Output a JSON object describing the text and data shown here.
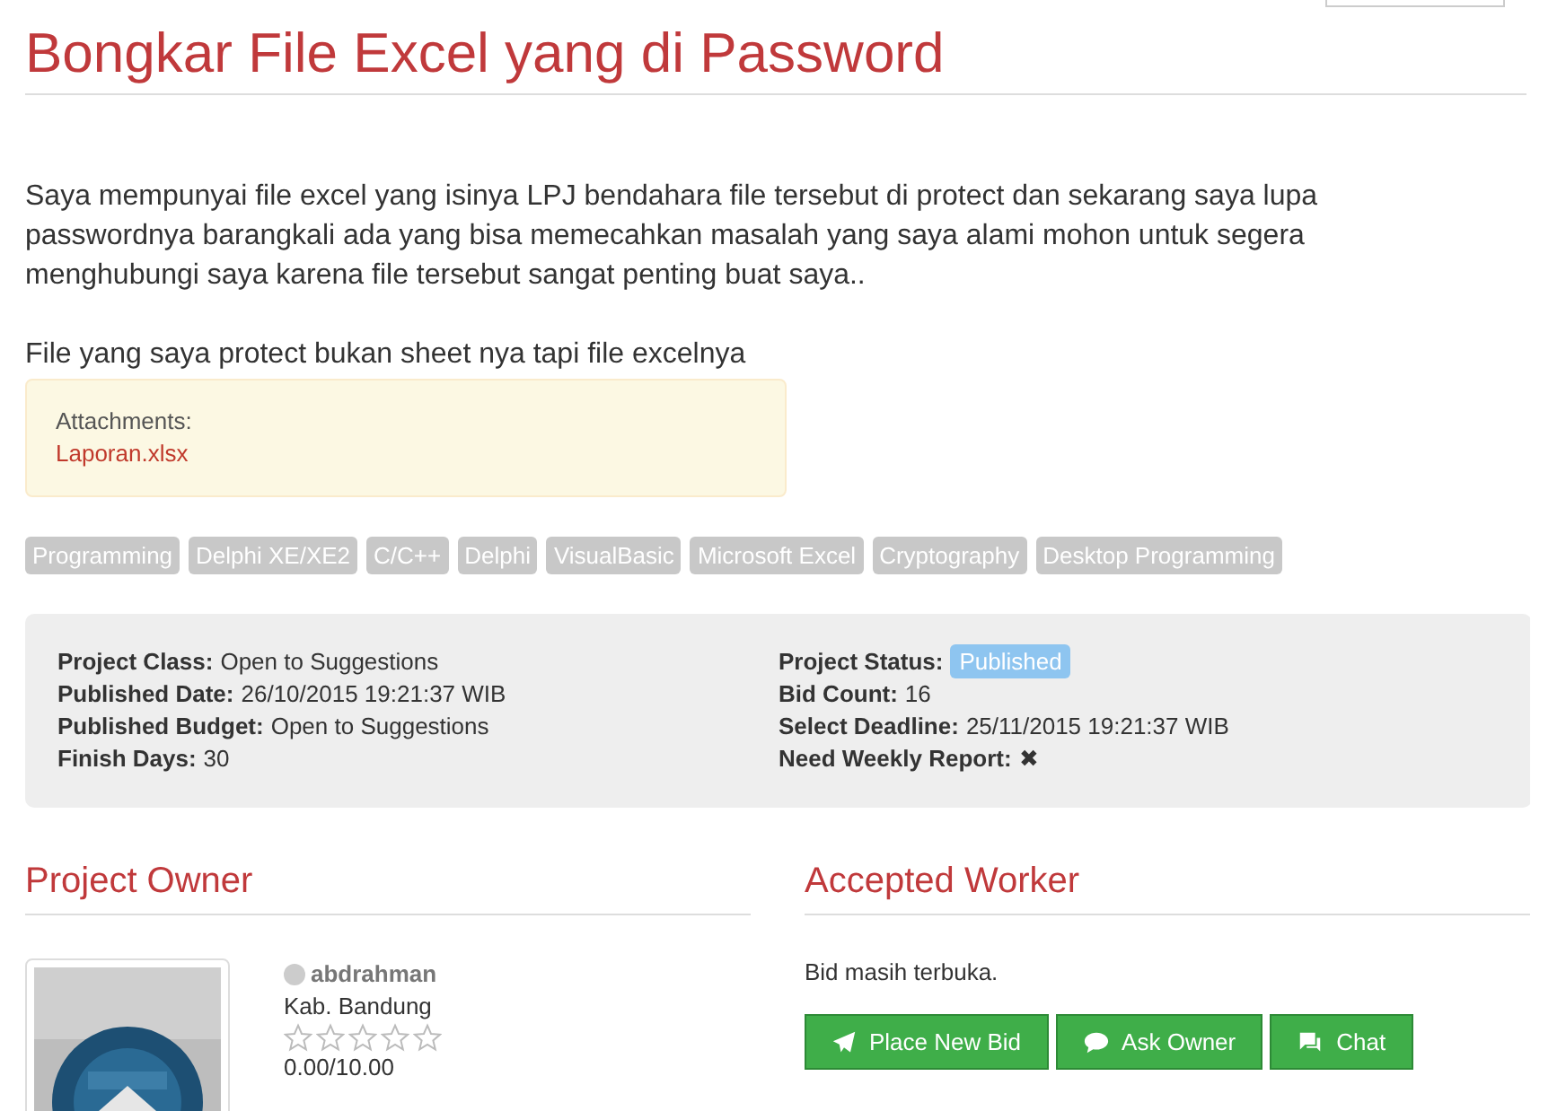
{
  "title": "Bongkar File Excel yang di Password",
  "description": [
    "Saya mempunyai file excel yang isinya LPJ bendahara file tersebut di protect dan sekarang saya lupa passwordnya barangkali ada yang bisa memecahkan masalah yang saya alami mohon untuk segera menghubungi saya karena file tersebut sangat penting buat saya..",
    "File yang saya protect bukan sheet nya tapi file excelnya"
  ],
  "attachments": {
    "label": "Attachments:",
    "files": [
      "Laporan.xlsx"
    ]
  },
  "tags": [
    "Programming",
    "Delphi XE/XE2",
    "C/C++",
    "Delphi",
    "VisualBasic",
    "Microsoft Excel",
    "Cryptography",
    "Desktop Programming"
  ],
  "details_left": [
    {
      "label": "Project Class:",
      "value": "Open to Suggestions"
    },
    {
      "label": "Published Date:",
      "value": "26/10/2015 19:21:37 WIB"
    },
    {
      "label": "Published Budget:",
      "value": "Open to Suggestions"
    },
    {
      "label": "Finish Days:",
      "value": "30"
    }
  ],
  "details_right": [
    {
      "label": "Project Status:",
      "value": "Published",
      "kind": "badge"
    },
    {
      "label": "Bid Count:",
      "value": "16",
      "kind": "text"
    },
    {
      "label": "Select Deadline:",
      "value": "25/11/2015 19:21:37 WIB",
      "kind": "text"
    },
    {
      "label": "Need Weekly Report:",
      "value": "✖",
      "kind": "text"
    }
  ],
  "owner": {
    "heading": "Project Owner",
    "name": "abdrahman",
    "online": false,
    "location": "Kab. Bandung",
    "stars": 0,
    "rating": "0.00/10.00"
  },
  "worker": {
    "heading": "Accepted Worker",
    "status": "Bid masih terbuka.",
    "buttons": [
      {
        "label": "Place New Bid",
        "kind": "send"
      },
      {
        "label": "Ask Owner",
        "kind": "comment"
      },
      {
        "label": "Chat",
        "kind": "chat"
      }
    ]
  }
}
